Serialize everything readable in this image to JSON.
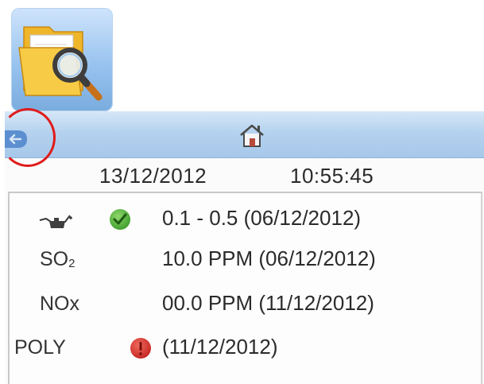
{
  "header": {
    "date": "13/12/2012",
    "time": "10:55:45"
  },
  "icons": {
    "app": "folder-search-icon",
    "back": "back-arrow-icon",
    "home": "home-icon",
    "oil": "oil-can-icon",
    "ok": "check-circle-icon",
    "alert": "alert-circle-icon"
  },
  "colors": {
    "titlebar": "#b5d2ee",
    "back_button": "#5b8fd0",
    "ok": "#4caf3a",
    "alert": "#d9302c",
    "highlight": "#e01b1b"
  },
  "readings": [
    {
      "label": "",
      "icon": "oil-can-icon",
      "status": "ok",
      "value": "0.1 - 0.5 (06/12/2012)"
    },
    {
      "label_main": "SO",
      "label_sub": "2",
      "status": "",
      "value": "10.0 PPM (06/12/2012)"
    },
    {
      "label": "NOx",
      "status": "",
      "value": "00.0 PPM (11/12/2012)"
    },
    {
      "label": "POLY",
      "status": "alert",
      "value": "(11/12/2012)"
    }
  ]
}
